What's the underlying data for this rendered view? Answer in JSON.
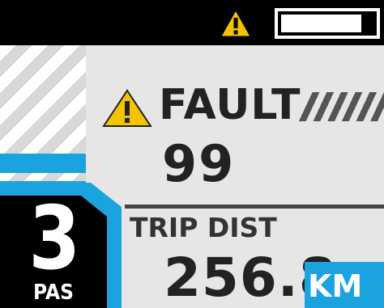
{
  "status": {
    "icon": "warning-triangle-icon",
    "battery": {
      "level": 0.87
    }
  },
  "fault": {
    "icon": "warning-triangle-icon",
    "label": "FAULT",
    "code": "99"
  },
  "assist": {
    "level": "3",
    "mode": "PAS",
    "bars_shown": 3
  },
  "trip": {
    "label": "TRIP DIST",
    "value": "256.8",
    "unit": "KM"
  },
  "colors": {
    "accent": "#1aa3df",
    "warning": "#f5c400",
    "background": "#e6e6e6",
    "bar": "#000000"
  }
}
